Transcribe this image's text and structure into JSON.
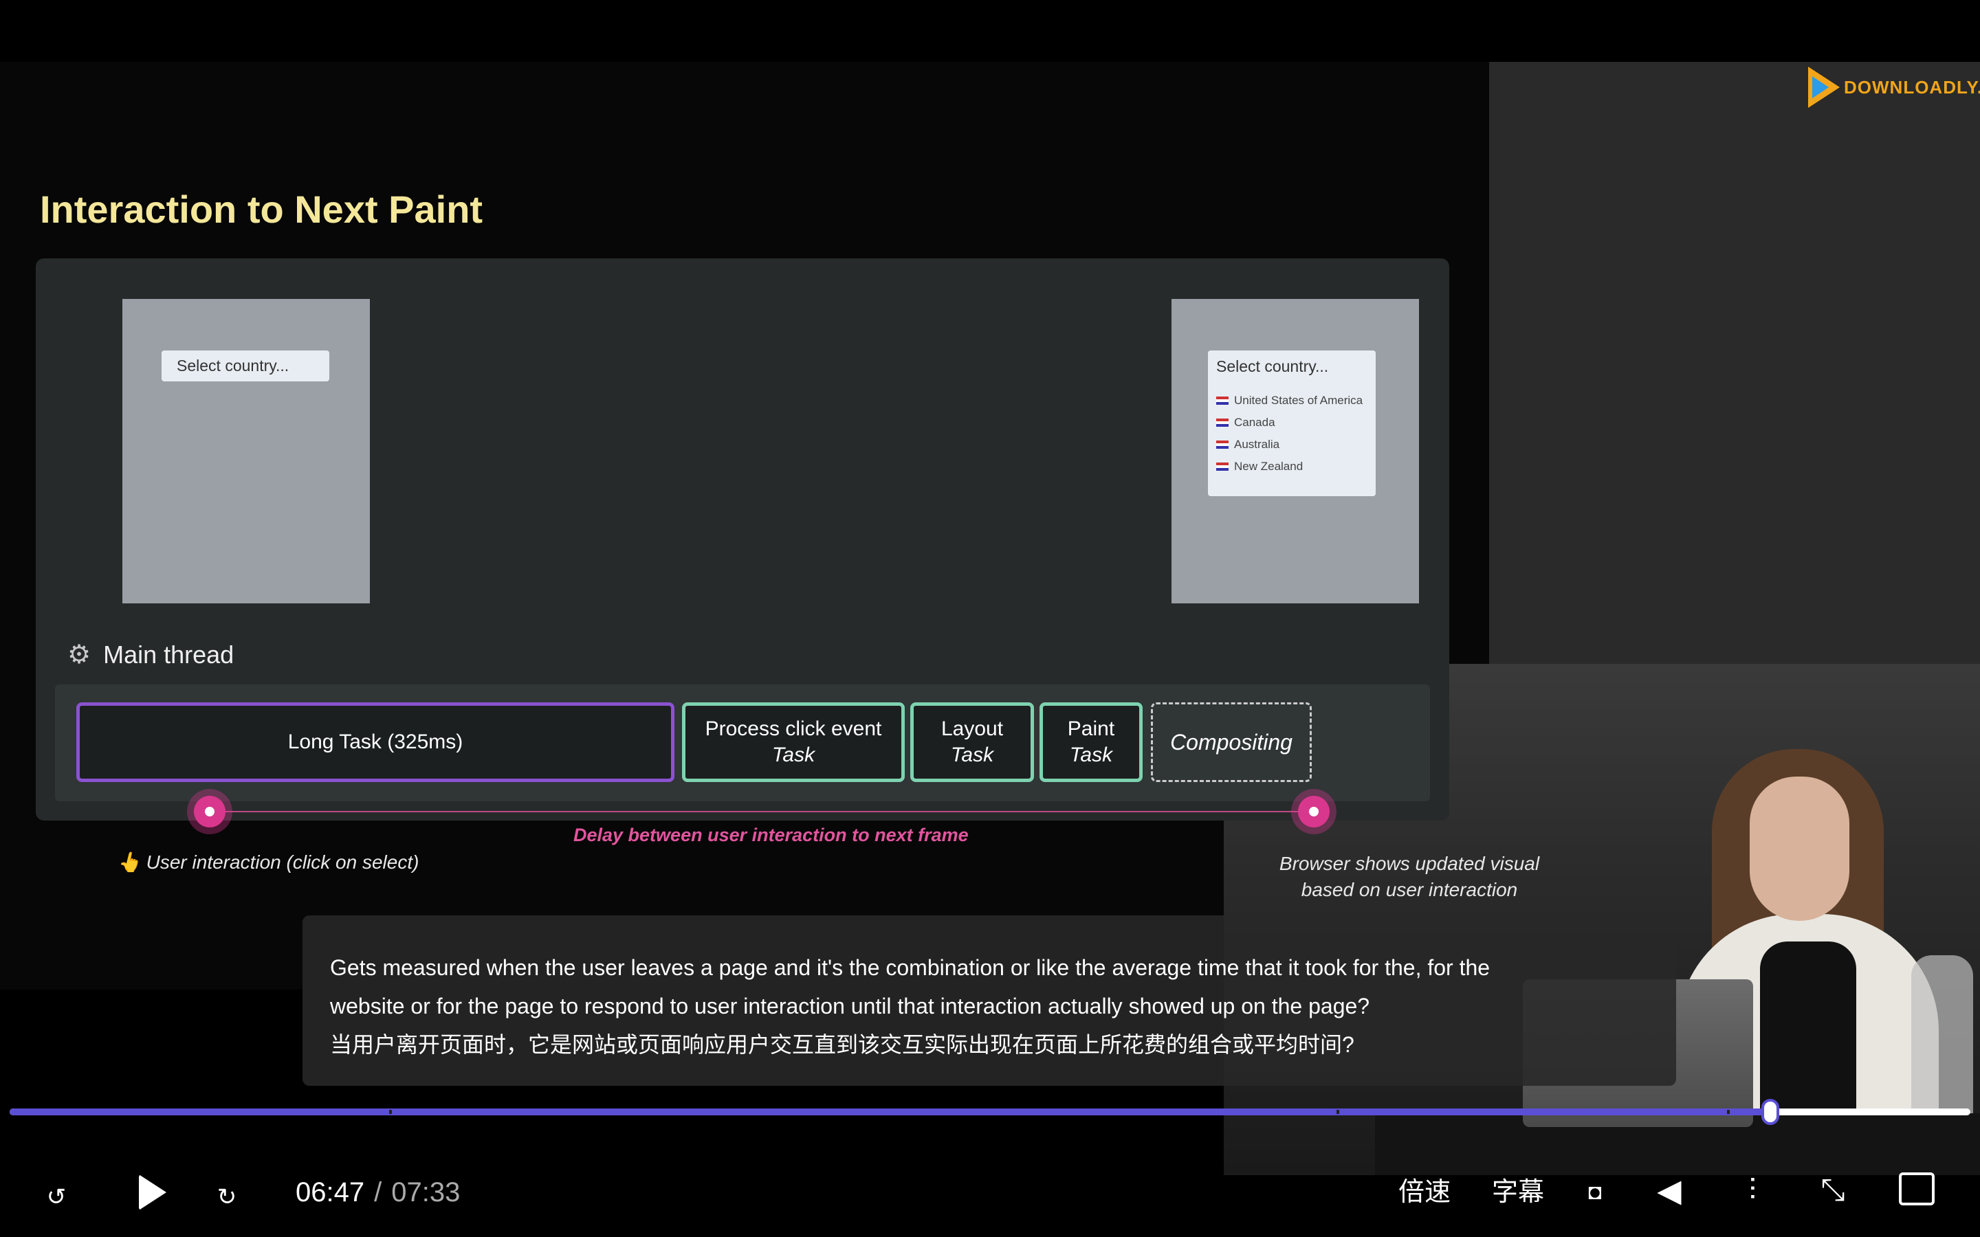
{
  "logo": {
    "text": "DOWNLOADLY.IR"
  },
  "slide": {
    "title": "Interaction to Next Paint",
    "select_placeholder": "Select country...",
    "countries": [
      "United States of America",
      "Canada",
      "Australia",
      "New Zealand"
    ],
    "main_thread_label": "Main thread",
    "tasks": {
      "long": "Long Task (325ms)",
      "click": {
        "title": "Process click event",
        "sub": "Task"
      },
      "layout": {
        "title": "Layout",
        "sub": "Task"
      },
      "paint": {
        "title": "Paint",
        "sub": "Task"
      },
      "compositing": "Compositing"
    },
    "delay_label": "Delay between user interaction to next frame",
    "user_label": "👆 User interaction (click on select)",
    "browser_label_line1": "Browser shows updated visual",
    "browser_label_line2": "based on user interaction"
  },
  "caption": {
    "line1": "Gets measured when the user leaves a page and it's the combination or like the average time that it took for the, for the",
    "line2": "website or for the page to respond to user interaction until that interaction actually showed up on the page?",
    "line3": "当用户离开页面时，它是网站或页面响应用户交互直到该交互实际出现在页面上所花费的组合或平均时间?"
  },
  "player": {
    "current_time": "06:47",
    "separator": "/",
    "duration": "07:33",
    "progress_fraction": 0.898,
    "speed_label": "倍速",
    "subtitle_label": "字幕",
    "accent": "#5b4fd6"
  }
}
